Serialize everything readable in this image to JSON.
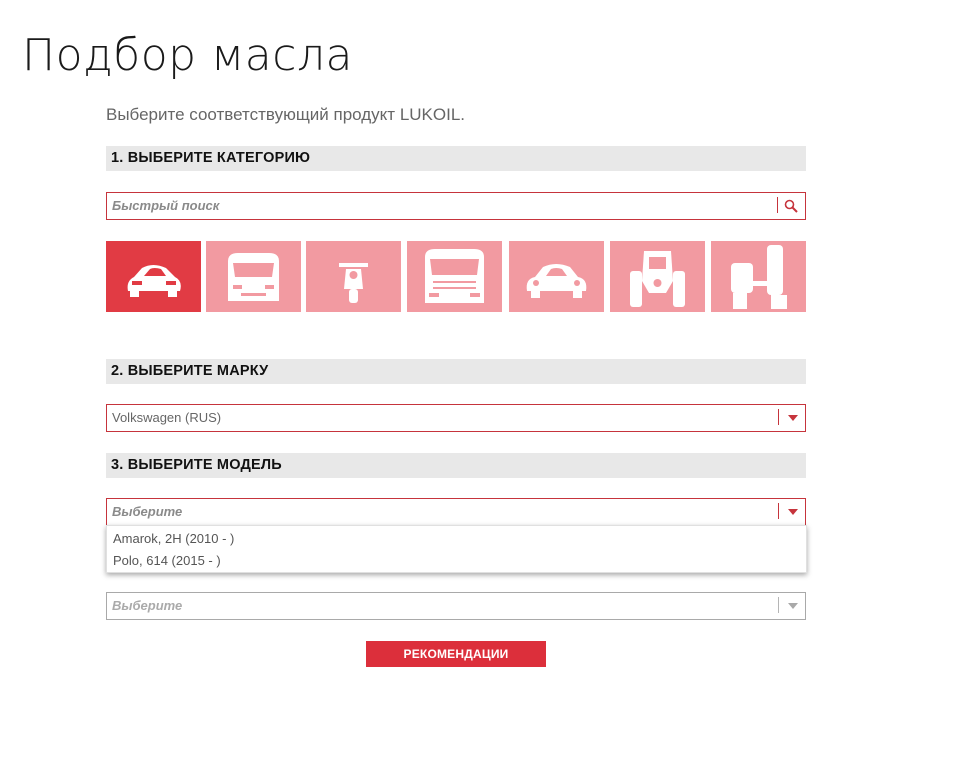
{
  "page": {
    "title": "Подбор масла",
    "intro": "Выберите соответствующий продукт LUKOIL."
  },
  "step1": {
    "heading": "1. ВЫБЕРИТЕ КАТЕГОРИЮ",
    "search_placeholder": "Быстрый поиск",
    "categories": [
      {
        "icon": "passenger-car-icon",
        "selected": true
      },
      {
        "icon": "van-icon",
        "selected": false
      },
      {
        "icon": "motorcycle-icon",
        "selected": false
      },
      {
        "icon": "truck-icon",
        "selected": false
      },
      {
        "icon": "classic-car-icon",
        "selected": false
      },
      {
        "icon": "tractor-icon",
        "selected": false
      },
      {
        "icon": "outboard-motor-icon",
        "selected": false
      }
    ]
  },
  "step2": {
    "heading": "2. ВЫБЕРИТЕ МАРКУ",
    "brand_value": "Volkswagen (RUS)"
  },
  "step3": {
    "heading": "3. ВЫБЕРИТЕ МОДЕЛЬ",
    "model_placeholder": "Выберите",
    "options": [
      "Amarok, 2H (2010 - )",
      "Polo, 614 (2015 - )"
    ]
  },
  "step4": {
    "placeholder": "Выберите"
  },
  "recommend_button": "РЕКОМЕНДАЦИИ",
  "colors": {
    "accent": "#dc2f3b",
    "tile_inactive": "#f29aa1",
    "tile_active": "#e13b44",
    "section_bg": "#e8e8e8"
  }
}
